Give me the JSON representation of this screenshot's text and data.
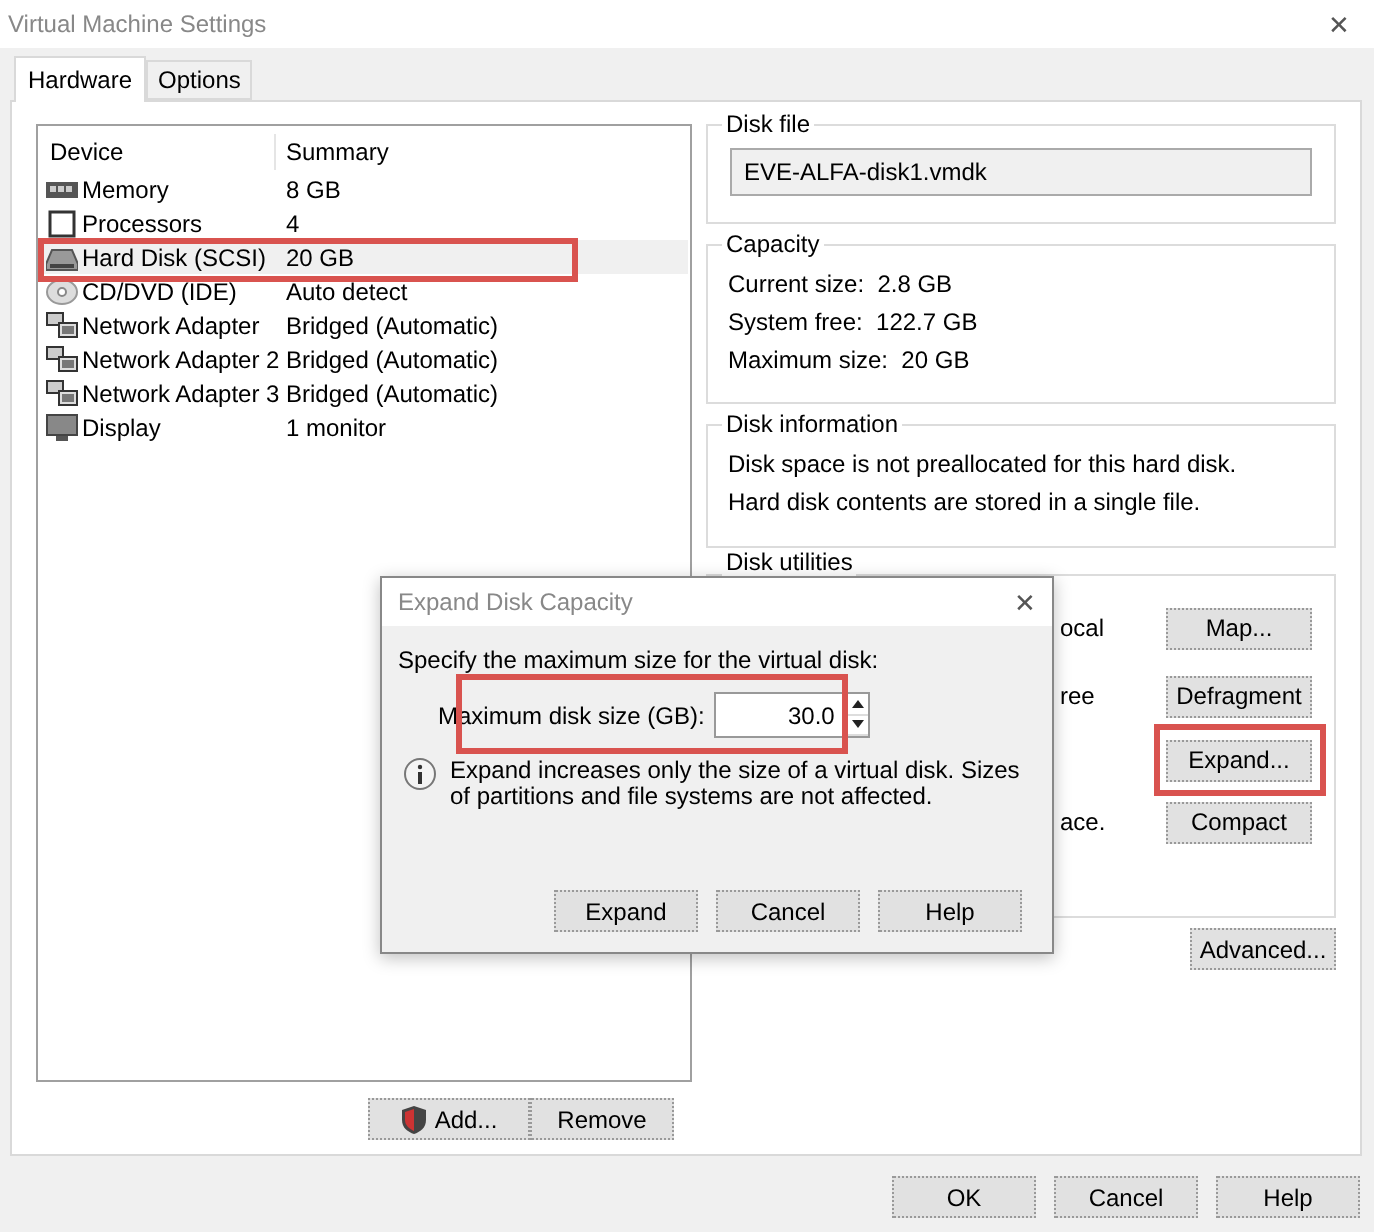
{
  "window": {
    "title": "Virtual Machine Settings",
    "close": "✕"
  },
  "tabs": [
    {
      "label": "Hardware",
      "selected": true
    },
    {
      "label": "Options",
      "selected": false
    }
  ],
  "devices": {
    "columns": [
      "Device",
      "Summary"
    ],
    "rows": [
      {
        "kind": "memory",
        "device": "Memory",
        "summary": "8 GB",
        "selected": false,
        "highlighted": false
      },
      {
        "kind": "processor",
        "device": "Processors",
        "summary": "4",
        "selected": false,
        "highlighted": false
      },
      {
        "kind": "disk",
        "device": "Hard Disk (SCSI)",
        "summary": "20 GB",
        "selected": true,
        "highlighted": true
      },
      {
        "kind": "cd",
        "device": "CD/DVD (IDE)",
        "summary": "Auto detect",
        "selected": false,
        "highlighted": false
      },
      {
        "kind": "network",
        "device": "Network Adapter",
        "summary": "Bridged (Automatic)",
        "selected": false,
        "highlighted": false
      },
      {
        "kind": "network",
        "device": "Network Adapter 2",
        "summary": "Bridged (Automatic)",
        "selected": false,
        "highlighted": false
      },
      {
        "kind": "network",
        "device": "Network Adapter 3",
        "summary": "Bridged (Automatic)",
        "selected": false,
        "highlighted": false
      },
      {
        "kind": "display",
        "device": "Display",
        "summary": "1 monitor",
        "selected": false,
        "highlighted": false
      }
    ],
    "buttons": [
      "Add...",
      "Remove"
    ]
  },
  "disk_file": {
    "title": "Disk file",
    "value": "EVE-ALFA-disk1.vmdk"
  },
  "capacity": {
    "title": "Capacity",
    "lines": [
      "Current size:  2.8 GB",
      "System free:  122.7 GB",
      "Maximum size:  20 GB"
    ]
  },
  "disk_information": {
    "title": "Disk information",
    "lines": [
      "Disk space is not preallocated for this hard disk.",
      "Hard disk contents are stored in a single file."
    ]
  },
  "disk_utilities": {
    "title": "Disk utilities",
    "rows": [
      {
        "text": "ocal",
        "button": "Map...",
        "highlighted": false
      },
      {
        "text": "ree",
        "button": "Defragment",
        "highlighted": false
      },
      {
        "text": "",
        "button": "Expand...",
        "highlighted": true
      },
      {
        "text": "ace.",
        "button": "Compact",
        "highlighted": false
      }
    ]
  },
  "advanced_button": "Advanced...",
  "footer_buttons": [
    "OK",
    "Cancel",
    "Help"
  ],
  "dialog": {
    "title": "Expand Disk Capacity",
    "close": "✕",
    "prompt": "Specify the maximum size for the virtual disk:",
    "field_label": "Maximum disk size (GB):",
    "field_value": "30.0",
    "field_highlighted": true,
    "info": "Expand increases only the size of a virtual disk. Sizes of partitions and file systems are not affected.",
    "buttons": [
      "Expand",
      "Cancel",
      "Help"
    ]
  }
}
